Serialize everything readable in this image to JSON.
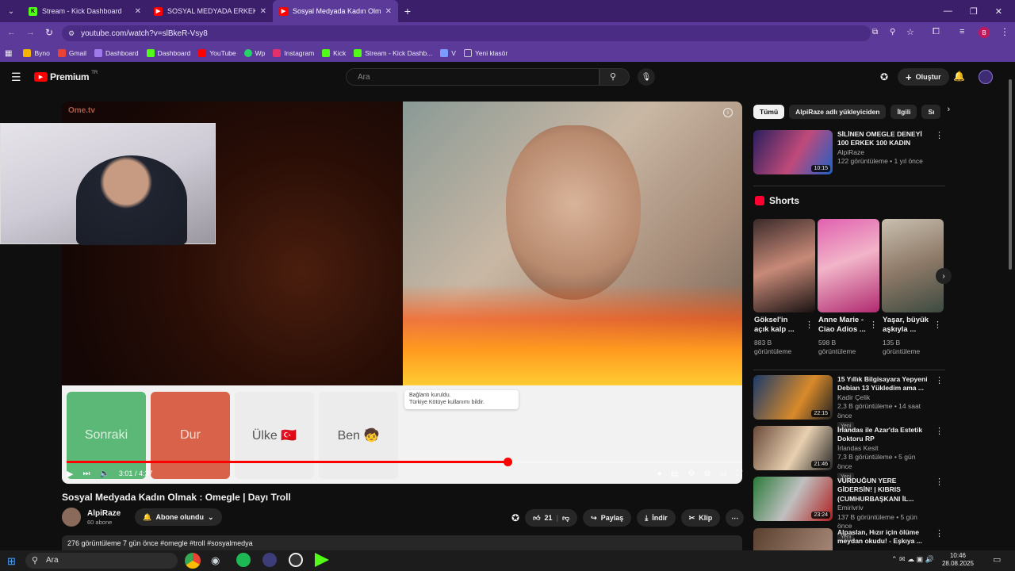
{
  "browser": {
    "tabs": [
      {
        "label": "Stream - Kick Dashboard",
        "color": "#53fc18",
        "icon": "kick-icon",
        "active": false
      },
      {
        "label": "SOSYAL MEDYADA ERKEK OLM",
        "color": "#ff0000",
        "icon": "youtube-icon",
        "active": false
      },
      {
        "label": "Sosyal Medyada Kadın Olmak :",
        "color": "#ff0000",
        "icon": "youtube-icon",
        "active": true
      }
    ],
    "url": "youtube.com/watch?v=slBkeR-Vsy8",
    "profile_letter": "B",
    "bookmarks": [
      {
        "label": "Byno",
        "color": "#f4b400"
      },
      {
        "label": "Gmail",
        "color": "#ea4335"
      },
      {
        "label": "Dashboard",
        "color": "#9f7aea"
      },
      {
        "label": "Dashboard",
        "color": "#53fc18"
      },
      {
        "label": "YouTube",
        "color": "#ff0000"
      },
      {
        "label": "Wp",
        "color": "#25d366"
      },
      {
        "label": "Instagram",
        "color": "#e1306c"
      },
      {
        "label": "Kick",
        "color": "#53fc18"
      },
      {
        "label": "Stream - Kick Dashb...",
        "color": "#53fc18"
      },
      {
        "label": "V",
        "color": "#7c9cff"
      },
      {
        "label": "Yeni klasör",
        "color": "#cccccc"
      }
    ]
  },
  "youtube": {
    "logo_text": "Premium",
    "logo_sup": "TR",
    "search_placeholder": "Ara",
    "create_label": "Oluştur"
  },
  "player": {
    "buttons": [
      {
        "label": "Sonraki",
        "color": "#5cb877"
      },
      {
        "label": "Dur",
        "color": "#d9634a"
      },
      {
        "label": "Ülke 🇹🇷",
        "color": "#eeeeee"
      },
      {
        "label": "Ben 🧒",
        "color": "#eeeeee"
      }
    ],
    "notice_line1": "Bağlantı kuruldu.",
    "notice_line2": "Türkiye  Kötüye kullanımı bildir.",
    "overlay_logo": "Ome.tv",
    "time": "3:01 / 4:37",
    "progress": 0.653
  },
  "video": {
    "title": "Sosyal Medyada Kadın Olmak : Omegle | Dayı Troll",
    "channel": "AlpiRaze",
    "subs": "60 abone",
    "subscribe_label": "Abone olundu",
    "likes": "21",
    "share_label": "Paylaş",
    "download_label": "İndir",
    "clip_label": "Klip",
    "desc": "276 görüntüleme  7 gün önce  #omegle #troll #sosyalmedya"
  },
  "sidebar": {
    "chips": [
      "Tümü",
      "AlpiRaze adlı yükleyiciden",
      "İlgili",
      "Sı"
    ],
    "top_video": {
      "title": "SİLİNEN OMEGLE DENEYİ 100 ERKEK 100 KADIN",
      "channel": "AlpiRaze",
      "meta": "122 görüntüleme • 1 yıl önce",
      "duration": "10:15"
    },
    "shorts_title": "Shorts",
    "shorts": [
      {
        "title": "Göksel'in açık kalp ...",
        "views": "883 B görüntüleme"
      },
      {
        "title": "Anne Marie - Ciao Adios ...",
        "views": "598 B görüntüleme"
      },
      {
        "title": "Yaşar, büyük aşkıyla ...",
        "views": "135 B görüntüleme"
      }
    ],
    "videos": [
      {
        "title": "15 Yıllık Bilgisayara Yepyeni Debian 13 Yükledim ama ...",
        "channel": "Kadir Çelik",
        "meta": "2,3 B görüntüleme • 14 saat önce",
        "badge": "Yeni",
        "duration": "22:15"
      },
      {
        "title": "İrlandas ile Azar'da Estetik Doktoru RP",
        "channel": "İrlandas Kesit",
        "meta": "7,3 B görüntüleme • 5 gün önce",
        "badge": "Yeni",
        "duration": "21:46"
      },
      {
        "title": "VURDUĞUN YERE GİDERSİN! | KIBRIS (CUMHURBAŞKANI İL...",
        "channel": "Emirivriv",
        "meta": "137 B görüntüleme • 5 gün önce",
        "badge": "Yeni",
        "duration": "23:24"
      },
      {
        "title": "Alpaslan, Hızır için ölüme meydan okudu! - Eşkıya ...",
        "channel": "",
        "meta": "",
        "badge": "",
        "duration": ""
      }
    ]
  },
  "taskbar": {
    "search_label": "Ara",
    "time": "10:46",
    "date": "28.08.2025"
  }
}
